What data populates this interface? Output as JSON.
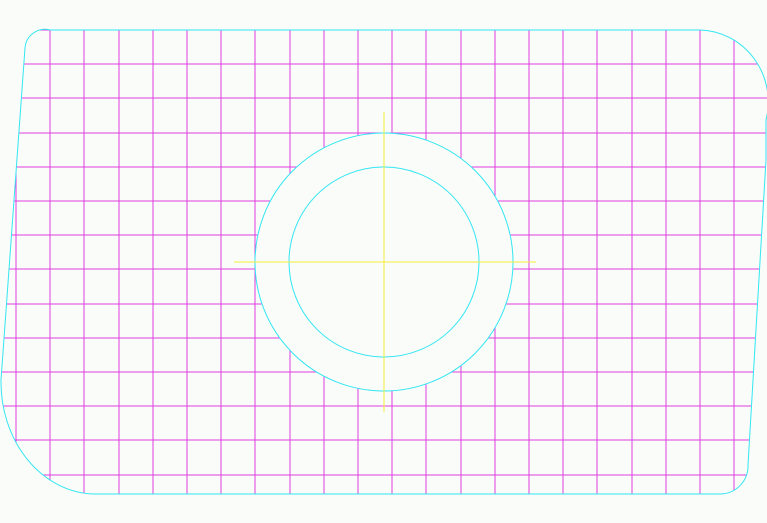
{
  "colors": {
    "background": "#fafcf9",
    "outline": "#33e6f2",
    "grid": "#dd3ee0",
    "centerlines": "#f2ee3a"
  },
  "icons": {
    "profile": "rounded-trapezoid-outline",
    "hole": "concentric-circles-icon",
    "crosshair": "crosshair-icon"
  }
}
